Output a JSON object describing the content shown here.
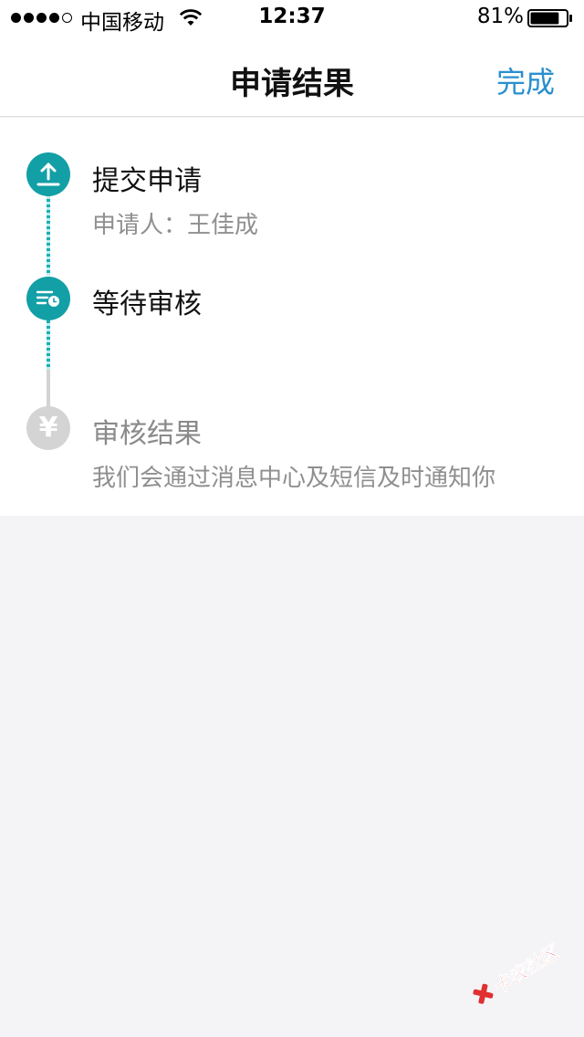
{
  "status_bar": {
    "carrier": "中国移动",
    "time": "12:37",
    "battery_percent": "81%",
    "battery_level": 0.81,
    "signal_bars": 4,
    "signal_total": 5
  },
  "nav": {
    "title": "申请结果",
    "done_label": "完成"
  },
  "timeline": {
    "steps": [
      {
        "title": "提交申请",
        "subtitle": "申请人：王佳成",
        "icon": "upload-icon",
        "state": "done"
      },
      {
        "title": "等待审核",
        "subtitle": "",
        "icon": "pending-review-icon",
        "state": "current"
      },
      {
        "title": "审核结果",
        "subtitle": "我们会通过消息中心及短信及时通知你",
        "icon": "yen-icon",
        "icon_glyph": "¥",
        "state": "upcoming"
      }
    ]
  },
  "watermark": {
    "text": "卡农社区"
  },
  "colors": {
    "accent": "#139fa6",
    "link": "#2a8fcf",
    "inactive": "#d4d4d4",
    "background": "#f4f4f7"
  }
}
